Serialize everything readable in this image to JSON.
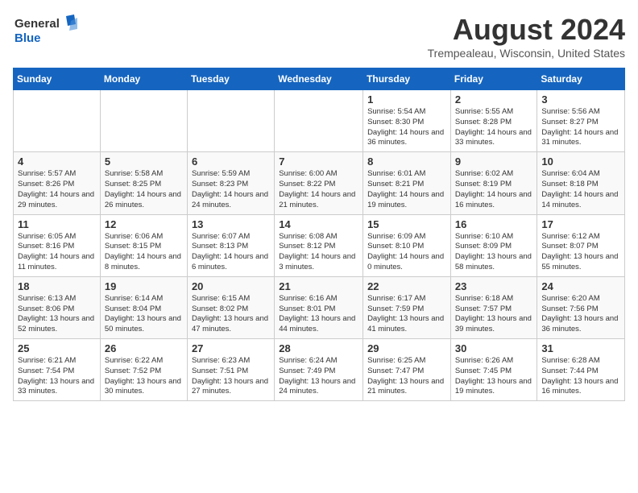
{
  "logo": {
    "line1": "General",
    "line2": "Blue"
  },
  "title": "August 2024",
  "location": "Trempealeau, Wisconsin, United States",
  "days_of_week": [
    "Sunday",
    "Monday",
    "Tuesday",
    "Wednesday",
    "Thursday",
    "Friday",
    "Saturday"
  ],
  "weeks": [
    [
      {
        "day": "",
        "info": ""
      },
      {
        "day": "",
        "info": ""
      },
      {
        "day": "",
        "info": ""
      },
      {
        "day": "",
        "info": ""
      },
      {
        "day": "1",
        "info": "Sunrise: 5:54 AM\nSunset: 8:30 PM\nDaylight: 14 hours\nand 36 minutes."
      },
      {
        "day": "2",
        "info": "Sunrise: 5:55 AM\nSunset: 8:28 PM\nDaylight: 14 hours\nand 33 minutes."
      },
      {
        "day": "3",
        "info": "Sunrise: 5:56 AM\nSunset: 8:27 PM\nDaylight: 14 hours\nand 31 minutes."
      }
    ],
    [
      {
        "day": "4",
        "info": "Sunrise: 5:57 AM\nSunset: 8:26 PM\nDaylight: 14 hours\nand 29 minutes."
      },
      {
        "day": "5",
        "info": "Sunrise: 5:58 AM\nSunset: 8:25 PM\nDaylight: 14 hours\nand 26 minutes."
      },
      {
        "day": "6",
        "info": "Sunrise: 5:59 AM\nSunset: 8:23 PM\nDaylight: 14 hours\nand 24 minutes."
      },
      {
        "day": "7",
        "info": "Sunrise: 6:00 AM\nSunset: 8:22 PM\nDaylight: 14 hours\nand 21 minutes."
      },
      {
        "day": "8",
        "info": "Sunrise: 6:01 AM\nSunset: 8:21 PM\nDaylight: 14 hours\nand 19 minutes."
      },
      {
        "day": "9",
        "info": "Sunrise: 6:02 AM\nSunset: 8:19 PM\nDaylight: 14 hours\nand 16 minutes."
      },
      {
        "day": "10",
        "info": "Sunrise: 6:04 AM\nSunset: 8:18 PM\nDaylight: 14 hours\nand 14 minutes."
      }
    ],
    [
      {
        "day": "11",
        "info": "Sunrise: 6:05 AM\nSunset: 8:16 PM\nDaylight: 14 hours\nand 11 minutes."
      },
      {
        "day": "12",
        "info": "Sunrise: 6:06 AM\nSunset: 8:15 PM\nDaylight: 14 hours\nand 8 minutes."
      },
      {
        "day": "13",
        "info": "Sunrise: 6:07 AM\nSunset: 8:13 PM\nDaylight: 14 hours\nand 6 minutes."
      },
      {
        "day": "14",
        "info": "Sunrise: 6:08 AM\nSunset: 8:12 PM\nDaylight: 14 hours\nand 3 minutes."
      },
      {
        "day": "15",
        "info": "Sunrise: 6:09 AM\nSunset: 8:10 PM\nDaylight: 14 hours\nand 0 minutes."
      },
      {
        "day": "16",
        "info": "Sunrise: 6:10 AM\nSunset: 8:09 PM\nDaylight: 13 hours\nand 58 minutes."
      },
      {
        "day": "17",
        "info": "Sunrise: 6:12 AM\nSunset: 8:07 PM\nDaylight: 13 hours\nand 55 minutes."
      }
    ],
    [
      {
        "day": "18",
        "info": "Sunrise: 6:13 AM\nSunset: 8:06 PM\nDaylight: 13 hours\nand 52 minutes."
      },
      {
        "day": "19",
        "info": "Sunrise: 6:14 AM\nSunset: 8:04 PM\nDaylight: 13 hours\nand 50 minutes."
      },
      {
        "day": "20",
        "info": "Sunrise: 6:15 AM\nSunset: 8:02 PM\nDaylight: 13 hours\nand 47 minutes."
      },
      {
        "day": "21",
        "info": "Sunrise: 6:16 AM\nSunset: 8:01 PM\nDaylight: 13 hours\nand 44 minutes."
      },
      {
        "day": "22",
        "info": "Sunrise: 6:17 AM\nSunset: 7:59 PM\nDaylight: 13 hours\nand 41 minutes."
      },
      {
        "day": "23",
        "info": "Sunrise: 6:18 AM\nSunset: 7:57 PM\nDaylight: 13 hours\nand 39 minutes."
      },
      {
        "day": "24",
        "info": "Sunrise: 6:20 AM\nSunset: 7:56 PM\nDaylight: 13 hours\nand 36 minutes."
      }
    ],
    [
      {
        "day": "25",
        "info": "Sunrise: 6:21 AM\nSunset: 7:54 PM\nDaylight: 13 hours\nand 33 minutes."
      },
      {
        "day": "26",
        "info": "Sunrise: 6:22 AM\nSunset: 7:52 PM\nDaylight: 13 hours\nand 30 minutes."
      },
      {
        "day": "27",
        "info": "Sunrise: 6:23 AM\nSunset: 7:51 PM\nDaylight: 13 hours\nand 27 minutes."
      },
      {
        "day": "28",
        "info": "Sunrise: 6:24 AM\nSunset: 7:49 PM\nDaylight: 13 hours\nand 24 minutes."
      },
      {
        "day": "29",
        "info": "Sunrise: 6:25 AM\nSunset: 7:47 PM\nDaylight: 13 hours\nand 21 minutes."
      },
      {
        "day": "30",
        "info": "Sunrise: 6:26 AM\nSunset: 7:45 PM\nDaylight: 13 hours\nand 19 minutes."
      },
      {
        "day": "31",
        "info": "Sunrise: 6:28 AM\nSunset: 7:44 PM\nDaylight: 13 hours\nand 16 minutes."
      }
    ]
  ]
}
